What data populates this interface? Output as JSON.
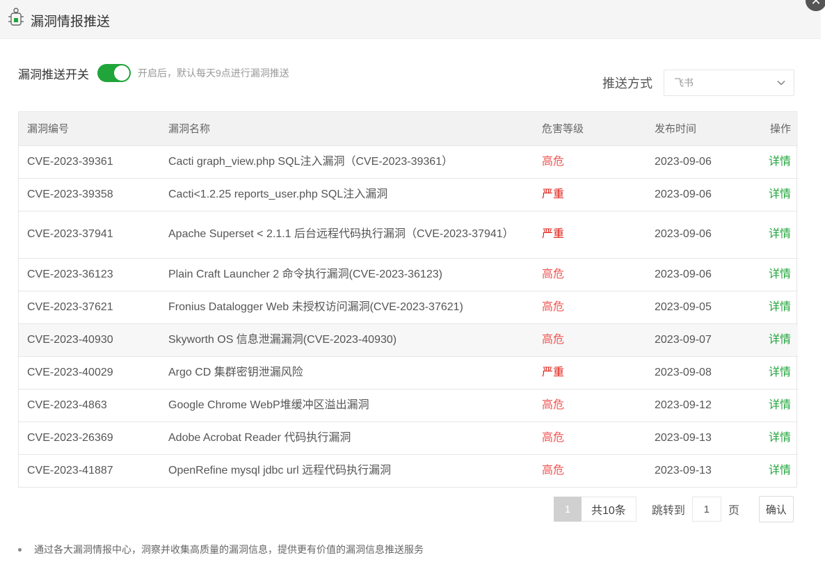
{
  "dialog": {
    "title": "漏洞情报推送",
    "close_label": "✕"
  },
  "switch": {
    "label": "漏洞推送开关",
    "on": true,
    "hint": "开启后，默认每天9点进行漏洞推送"
  },
  "push_method": {
    "label": "推送方式",
    "selected": "飞书"
  },
  "table": {
    "headers": [
      "漏洞编号",
      "漏洞名称",
      "危害等级",
      "发布时间",
      "操作"
    ],
    "rows": [
      {
        "id": "CVE-2023-39361",
        "name": "Cacti graph_view.php SQL注入漏洞（CVE-2023-39361）",
        "level": "高危",
        "date": "2023-09-06",
        "op": "详情"
      },
      {
        "id": "CVE-2023-39358",
        "name": "Cacti<1.2.25 reports_user.php SQL注入漏洞",
        "level": "严重",
        "date": "2023-09-06",
        "op": "详情"
      },
      {
        "id": "CVE-2023-37941",
        "name": "Apache Superset < 2.1.1 后台远程代码执行漏洞（CVE-2023-37941）",
        "level": "严重",
        "date": "2023-09-06",
        "op": "详情"
      },
      {
        "id": "CVE-2023-36123",
        "name": "Plain Craft Launcher 2 命令执行漏洞(CVE-2023-36123)",
        "level": "高危",
        "date": "2023-09-06",
        "op": "详情"
      },
      {
        "id": "CVE-2023-37621",
        "name": "Fronius Datalogger Web 未授权访问漏洞(CVE-2023-37621)",
        "level": "高危",
        "date": "2023-09-05",
        "op": "详情"
      },
      {
        "id": "CVE-2023-40930",
        "name": "Skyworth OS 信息泄漏漏洞(CVE-2023-40930)",
        "level": "高危",
        "date": "2023-09-07",
        "op": "详情"
      },
      {
        "id": "CVE-2023-40029",
        "name": "Argo CD 集群密钥泄漏风险",
        "level": "严重",
        "date": "2023-09-08",
        "op": "详情"
      },
      {
        "id": "CVE-2023-4863",
        "name": "Google Chrome WebP堆缓冲区溢出漏洞",
        "level": "高危",
        "date": "2023-09-12",
        "op": "详情"
      },
      {
        "id": "CVE-2023-26369",
        "name": "Adobe Acrobat Reader 代码执行漏洞",
        "level": "高危",
        "date": "2023-09-13",
        "op": "详情"
      },
      {
        "id": "CVE-2023-41887",
        "name": "OpenRefine mysql jdbc url 远程代码执行漏洞",
        "level": "高危",
        "date": "2023-09-13",
        "op": "详情"
      }
    ]
  },
  "pager": {
    "current": "1",
    "total": "共10条",
    "jump_label": "跳转到",
    "jump_value": "1",
    "unit": "页",
    "confirm": "确认"
  },
  "footer": {
    "note": "通过各大漏洞情报中心，洞察并收集高质量的漏洞信息，提供更有价值的漏洞信息推送服务"
  },
  "colors": {
    "accent": "#20a53a",
    "high": "#ef5350",
    "severe": "#e0201a"
  },
  "icons": {
    "header": "bug-robot-icon",
    "select": "chevron-down-icon"
  }
}
